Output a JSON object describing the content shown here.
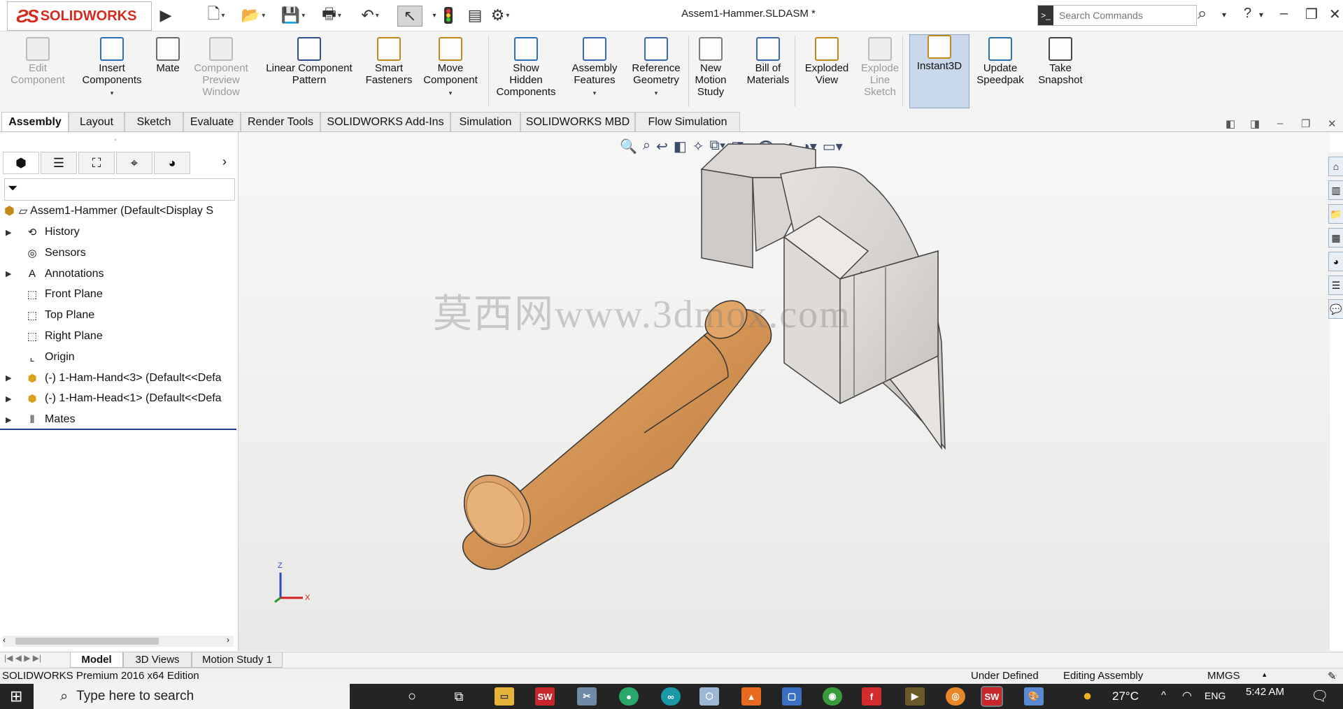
{
  "app": {
    "brand": "SOLIDWORKS",
    "doc_title": "Assem1-Hammer.SLDASM *"
  },
  "search": {
    "placeholder": "Search Commands"
  },
  "colors": {
    "brand_red": "#d52b1e",
    "handle_wood": "#d79a5e",
    "head_metal": "#d6d2d0",
    "active_button": "#c9d8ea"
  },
  "command_manager": [
    {
      "label": "Edit\nComponent",
      "icon": "edit-component-icon",
      "disabled": true
    },
    {
      "label": "Insert\nComponents",
      "icon": "insert-components-icon"
    },
    {
      "label": "Mate",
      "icon": "mate-icon"
    },
    {
      "label": "Component\nPreview\nWindow",
      "icon": "preview-window-icon",
      "disabled": true
    },
    {
      "label": "Linear Component\nPattern",
      "icon": "linear-pattern-icon"
    },
    {
      "label": "Smart\nFasteners",
      "icon": "smart-fasteners-icon"
    },
    {
      "label": "Move\nComponent",
      "icon": "move-component-icon"
    },
    {
      "label": "Show\nHidden\nComponents",
      "icon": "show-hidden-icon"
    },
    {
      "label": "Assembly\nFeatures",
      "icon": "assembly-features-icon"
    },
    {
      "label": "Reference\nGeometry",
      "icon": "reference-geometry-icon"
    },
    {
      "label": "New\nMotion\nStudy",
      "icon": "motion-study-icon"
    },
    {
      "label": "Bill of\nMaterials",
      "icon": "bom-icon"
    },
    {
      "label": "Exploded\nView",
      "icon": "exploded-view-icon"
    },
    {
      "label": "Explode\nLine\nSketch",
      "icon": "explode-line-icon",
      "disabled": true
    },
    {
      "label": "Instant3D",
      "icon": "instant3d-icon",
      "active": true
    },
    {
      "label": "Update\nSpeedpak",
      "icon": "speedpak-icon"
    },
    {
      "label": "Take\nSnapshot",
      "icon": "camera-icon"
    }
  ],
  "tabs": [
    "Assembly",
    "Layout",
    "Sketch",
    "Evaluate",
    "Render Tools",
    "SOLIDWORKS Add-Ins",
    "Simulation",
    "SOLIDWORKS MBD",
    "Flow Simulation"
  ],
  "tree": {
    "root": "Assem1-Hammer  (Default<Display S",
    "items": [
      {
        "label": "History",
        "expandable": true,
        "icon": "history-icon"
      },
      {
        "label": "Sensors",
        "expandable": false,
        "icon": "sensors-icon"
      },
      {
        "label": "Annotations",
        "expandable": true,
        "icon": "annotations-icon"
      },
      {
        "label": "Front Plane",
        "expandable": false,
        "icon": "plane-icon"
      },
      {
        "label": "Top Plane",
        "expandable": false,
        "icon": "plane-icon"
      },
      {
        "label": "Right Plane",
        "expandable": false,
        "icon": "plane-icon"
      },
      {
        "label": "Origin",
        "expandable": false,
        "icon": "origin-icon"
      },
      {
        "label": "(-) 1-Ham-Hand<3> (Default<<Defa",
        "expandable": true,
        "icon": "part-icon"
      },
      {
        "label": "(-) 1-Ham-Head<1> (Default<<Defa",
        "expandable": true,
        "icon": "part-icon"
      },
      {
        "label": "Mates",
        "expandable": true,
        "icon": "mates-icon"
      }
    ]
  },
  "viewport": {
    "watermark": "莫西网www.3dmox.com",
    "triad": {
      "x": "X",
      "z": "Z"
    }
  },
  "bottom_tabs": [
    "Model",
    "3D Views",
    "Motion Study 1"
  ],
  "status": {
    "edition": "SOLIDWORKS Premium 2016 x64 Edition",
    "state": "Under Defined",
    "mode": "Editing Assembly",
    "units": "MMGS"
  },
  "taskbar": {
    "search_placeholder": "Type here to search",
    "temperature": "27°C",
    "language": "ENG",
    "time": "5:42 AM"
  }
}
